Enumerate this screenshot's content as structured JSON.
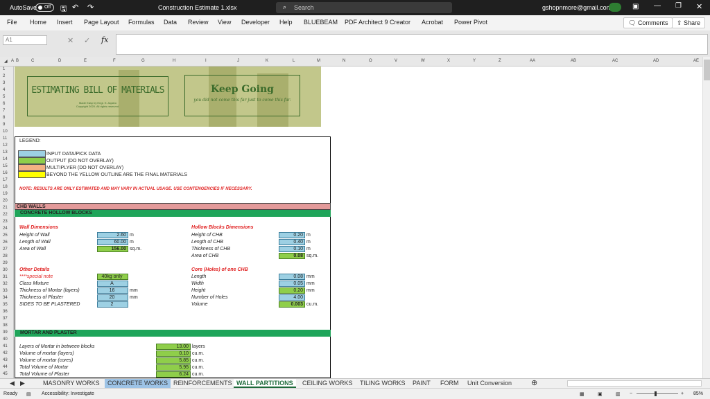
{
  "titlebar": {
    "autosave": "AutoSave",
    "toggle": "Off",
    "filename": "Construction Estimate 1.xlsx",
    "search_placeholder": "Search",
    "account": "gshopnmore@gmail.com"
  },
  "menu": [
    "File",
    "Home",
    "Insert",
    "Page Layout",
    "Formulas",
    "Data",
    "Review",
    "View",
    "Developer",
    "Help",
    "BLUEBEAM",
    "PDF Architect 9 Creator",
    "Acrobat",
    "Power Pivot"
  ],
  "comments_label": "Comments",
  "share_label": "Share",
  "namebox": "A1",
  "fx": "fx",
  "columns": [
    "A",
    "B",
    "C",
    "D",
    "E",
    "F",
    "G",
    "H",
    "I",
    "J",
    "K",
    "L",
    "M",
    "N",
    "O",
    "V",
    "W",
    "X",
    "Y",
    "Z",
    "AA",
    "AB",
    "AC",
    "AD",
    "AE"
  ],
  "banner": {
    "title": "ESTIMATING BILL OF MATERIALS",
    "credit1": "Made Easy by Engr. E. Aquino",
    "credit2": "Copyright 2020. All rights reserved.",
    "motto": "Keep Going",
    "motto_sub": "you did not come this far just to come this far."
  },
  "legend": {
    "title": "LEGEND:",
    "items": [
      "INPUT DATA/PICK DATA",
      "OUTPUT (DO NOT OVERLAY)",
      "MULTIPLYER (DO NOT OVERLAY)",
      "BEYOND THE YELLOW OUTLINE ARE THE FINAL MATERIALS"
    ],
    "colors": [
      "#9dd0e3",
      "#8fce4a",
      "#f4b183",
      "#ffff00"
    ]
  },
  "note": "NOTE: RESULTS ARE ONLY ESTIMATED AND MAY VARY IN ACTUAL USAGE. USE CONTENGENCIES IF NECESSARY.",
  "section1": "CHB WALLS",
  "section2": "CONCRETE HOLLOW BLOCKS",
  "wall": {
    "title": "Wall Dimensions",
    "h_label": "Height of Wall",
    "h": "2.60",
    "l_label": "Length of Wall",
    "l": "60.00",
    "a_label": "Area of Wall",
    "a": "156.00",
    "m": "m",
    "sqm": "sq.m."
  },
  "hollow": {
    "title": "Hollow Blocks Dimensions",
    "h_label": "Height of CHB",
    "h": "0.20",
    "l_label": "Length of CHB",
    "l": "0.40",
    "t_label": "Thickness of CHB",
    "t": "0.10",
    "a_label": "Area of CHB",
    "a": "0.08"
  },
  "other": {
    "title": "Other Details",
    "note_label": "****special note",
    "note_val": "40kg only",
    "cm_label": "Class Mixture",
    "cm": "A",
    "tm_label": "Thickness of Mortar (layers)",
    "tm": "16",
    "tp_label": "Thickness of Plaster",
    "tp": "20",
    "sp_label": "SIDES TO BE PLASTERED",
    "sp": "2",
    "mm": "mm"
  },
  "core": {
    "title": "Core (Holes) of one CHB",
    "len_label": "Length",
    "len": "0.08",
    "w_label": "Width",
    "w": "0.05",
    "h_label": "Height",
    "h": "0.20",
    "n_label": "Number of Holes",
    "n": "4.00",
    "v_label": "Volume",
    "v": "0.003",
    "mm": "mm",
    "cum": "cu.m."
  },
  "section3": "MORTAR AND PLASTER",
  "mortar": {
    "l1": "Layers of Mortar in between blocks",
    "v1": "13.00",
    "u1": "layers",
    "l2": "Volume of mortar (layers)",
    "v2": "0.10",
    "l3": "Volume of mortar (cores)",
    "v3": "5.85",
    "l4": "Total Volume of Mortar",
    "v4": "5.95",
    "l5": "Total Volume of Plaster",
    "v5": "6.24",
    "cum": "cu.m."
  },
  "tabs": [
    "MASONRY WORKS",
    "CONCRETE WORKS",
    "REINFORCEMENTS",
    "WALL PARTITIONS",
    "CEILING WORKS",
    "TILING WORKS",
    "PAINT",
    "FORM",
    "Unit Conversion"
  ],
  "status": {
    "ready": "Ready",
    "accessibility": "Accessibility: Investigate",
    "zoom": "85%"
  }
}
